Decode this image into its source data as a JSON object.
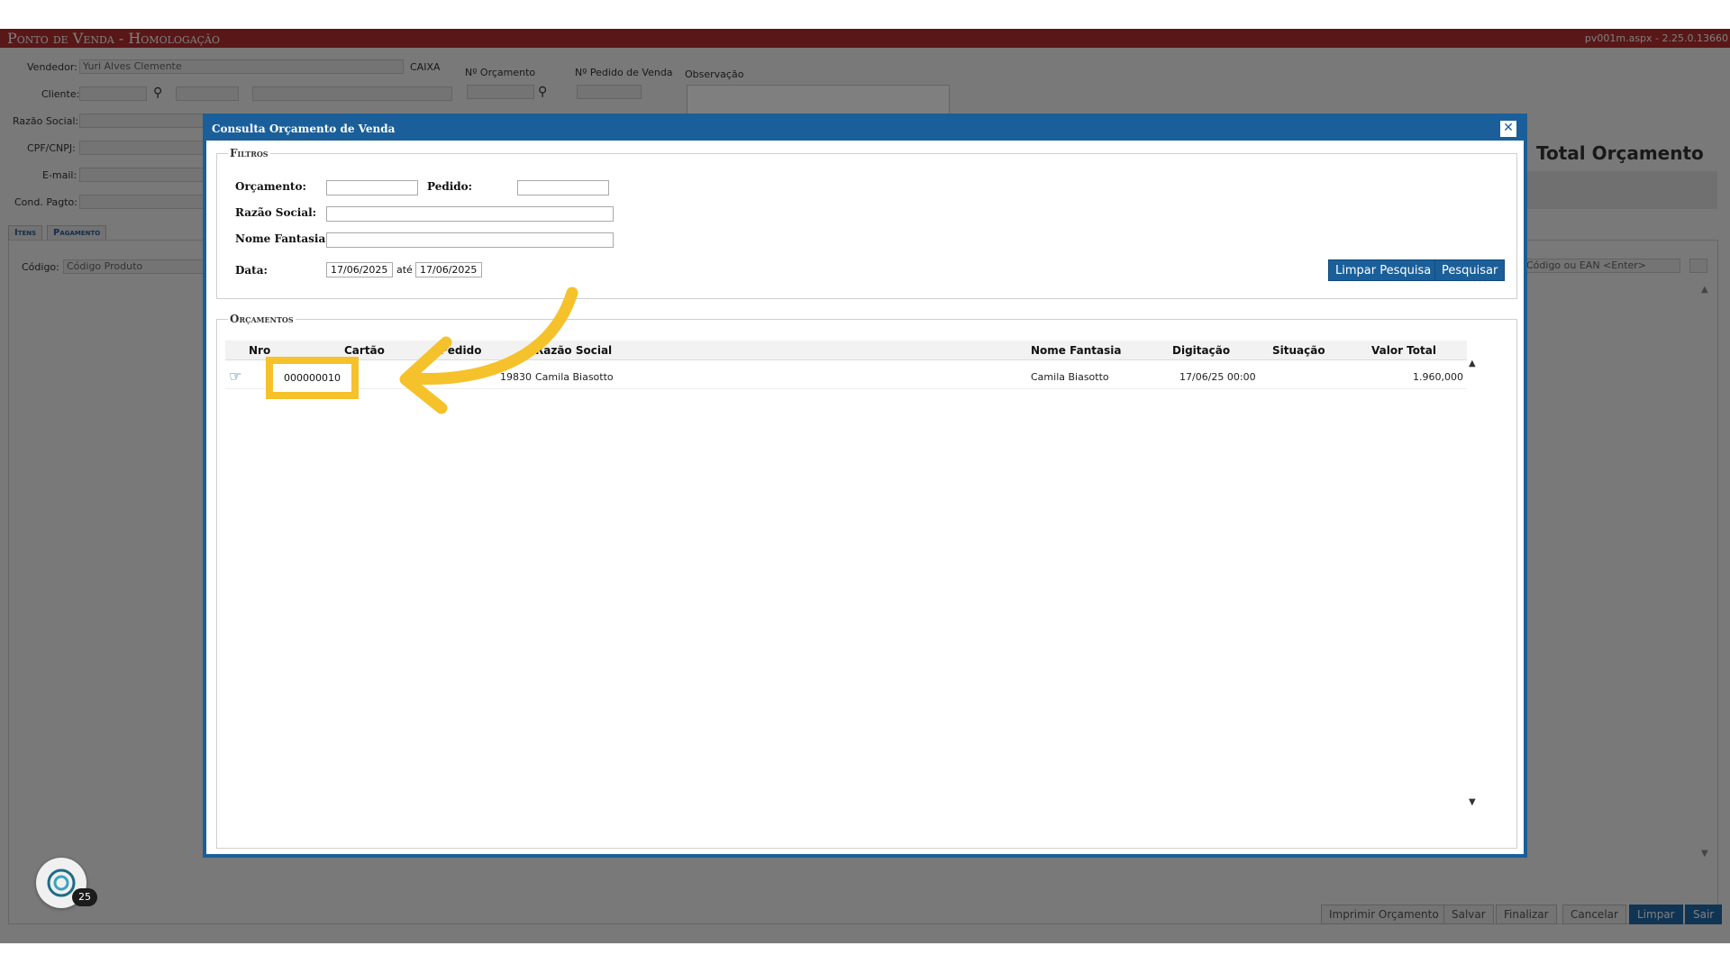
{
  "app": {
    "title": "Ponto de Venda - Homologação",
    "version": "pv001m.aspx - 2.25.0.13660",
    "vendedor_label": "Vendedor:",
    "vendedor_value": "Yuri Alves Clemente",
    "caixa_label": "CAIXA",
    "orcamento_label": "Nº Orçamento",
    "pedido_venda_label": "Nº Pedido de Venda",
    "observacao_label": "Observação",
    "cliente_label": "Cliente:",
    "razao_label": "Razão Social:",
    "cpf_label": "CPF/CNPJ:",
    "email_label": "E-mail:",
    "cond_label": "Cond. Pagto:",
    "total_label": "Total Orçamento",
    "tabs": [
      "Itens",
      "Pagamento"
    ],
    "codigo_label": "Código:",
    "codigo_placeholder": "Código Produto",
    "ean_placeholder": "Código ou EAN <Enter>",
    "footer_buttons": [
      "Imprimir Orçamento",
      "Salvar",
      "Finalizar",
      "Cancelar",
      "Limpar",
      "Sair"
    ]
  },
  "dialog": {
    "title": "Consulta Orçamento de Venda",
    "filters": {
      "legend": "Filtros",
      "orcamento_label": "Orçamento:",
      "pedido_label": "Pedido:",
      "razao_label": "Razão Social:",
      "fantasia_label": "Nome Fantasia:",
      "data_label": "Data:",
      "date_from": "17/06/2025",
      "ate_label": "até",
      "date_to": "17/06/2025",
      "clear_button": "Limpar Pesquisa",
      "search_button": "Pesquisar"
    },
    "results": {
      "legend": "Orçamentos",
      "columns": [
        "Nro",
        "Cartão",
        "Pedido",
        "Razão Social",
        "Nome Fantasia",
        "Digitação",
        "Situação",
        "Valor Total"
      ],
      "rows": [
        {
          "nro": "000000010",
          "cartao": "",
          "pedido": "",
          "razao_code": "19830",
          "razao_name": "Camila Biasotto",
          "fantasia": "Camila Biasotto",
          "digitacao": "17/06/25 00:00",
          "situacao": "",
          "valor": "1.960,000"
        }
      ]
    }
  },
  "assistant": {
    "badge": "25"
  },
  "colors": {
    "accent": "#1a5f9a",
    "title_bar": "#b22f2f",
    "highlight": "#f5c22b"
  }
}
